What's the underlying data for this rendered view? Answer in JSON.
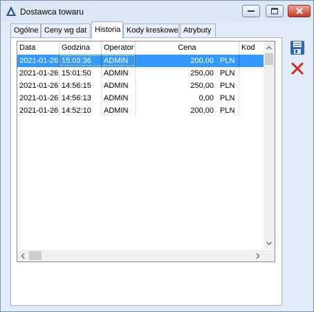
{
  "window": {
    "title": "Dostawca towaru",
    "buttons": {
      "minimize": "minimize-icon",
      "maximize": "maximize-icon",
      "close": "close-icon"
    }
  },
  "tabs": [
    {
      "label": "Ogólne"
    },
    {
      "label": "Ceny wg dat"
    },
    {
      "label": "Historia",
      "active": true
    },
    {
      "label": "Kody kreskowe"
    },
    {
      "label": "Atrybuty"
    }
  ],
  "grid": {
    "columns": [
      "Data",
      "Godzina",
      "Operator",
      "Cena",
      "Kod"
    ],
    "rows": [
      {
        "date": "2021-01-26",
        "time": "15:03:36",
        "operator": "ADMIN",
        "price": "200,00",
        "currency": "PLN",
        "selected": true
      },
      {
        "date": "2021-01-26",
        "time": "15:01:50",
        "operator": "ADMIN",
        "price": "250,00",
        "currency": "PLN"
      },
      {
        "date": "2021-01-26",
        "time": "14:56:15",
        "operator": "ADMIN",
        "price": "250,00",
        "currency": "PLN"
      },
      {
        "date": "2021-01-26",
        "time": "14:56:13",
        "operator": "ADMIN",
        "price": "0,00",
        "currency": "PLN"
      },
      {
        "date": "2021-01-26",
        "time": "14:52:10",
        "operator": "ADMIN",
        "price": "200,00",
        "currency": "PLN"
      }
    ]
  },
  "side_buttons": {
    "save": "floppy-disk-icon",
    "cancel": "red-x-icon"
  },
  "colors": {
    "selection": "#3399ff",
    "window_bg": "#e1ebf7",
    "close_button": "#c53a27",
    "save_icon": "#2f64b6"
  }
}
